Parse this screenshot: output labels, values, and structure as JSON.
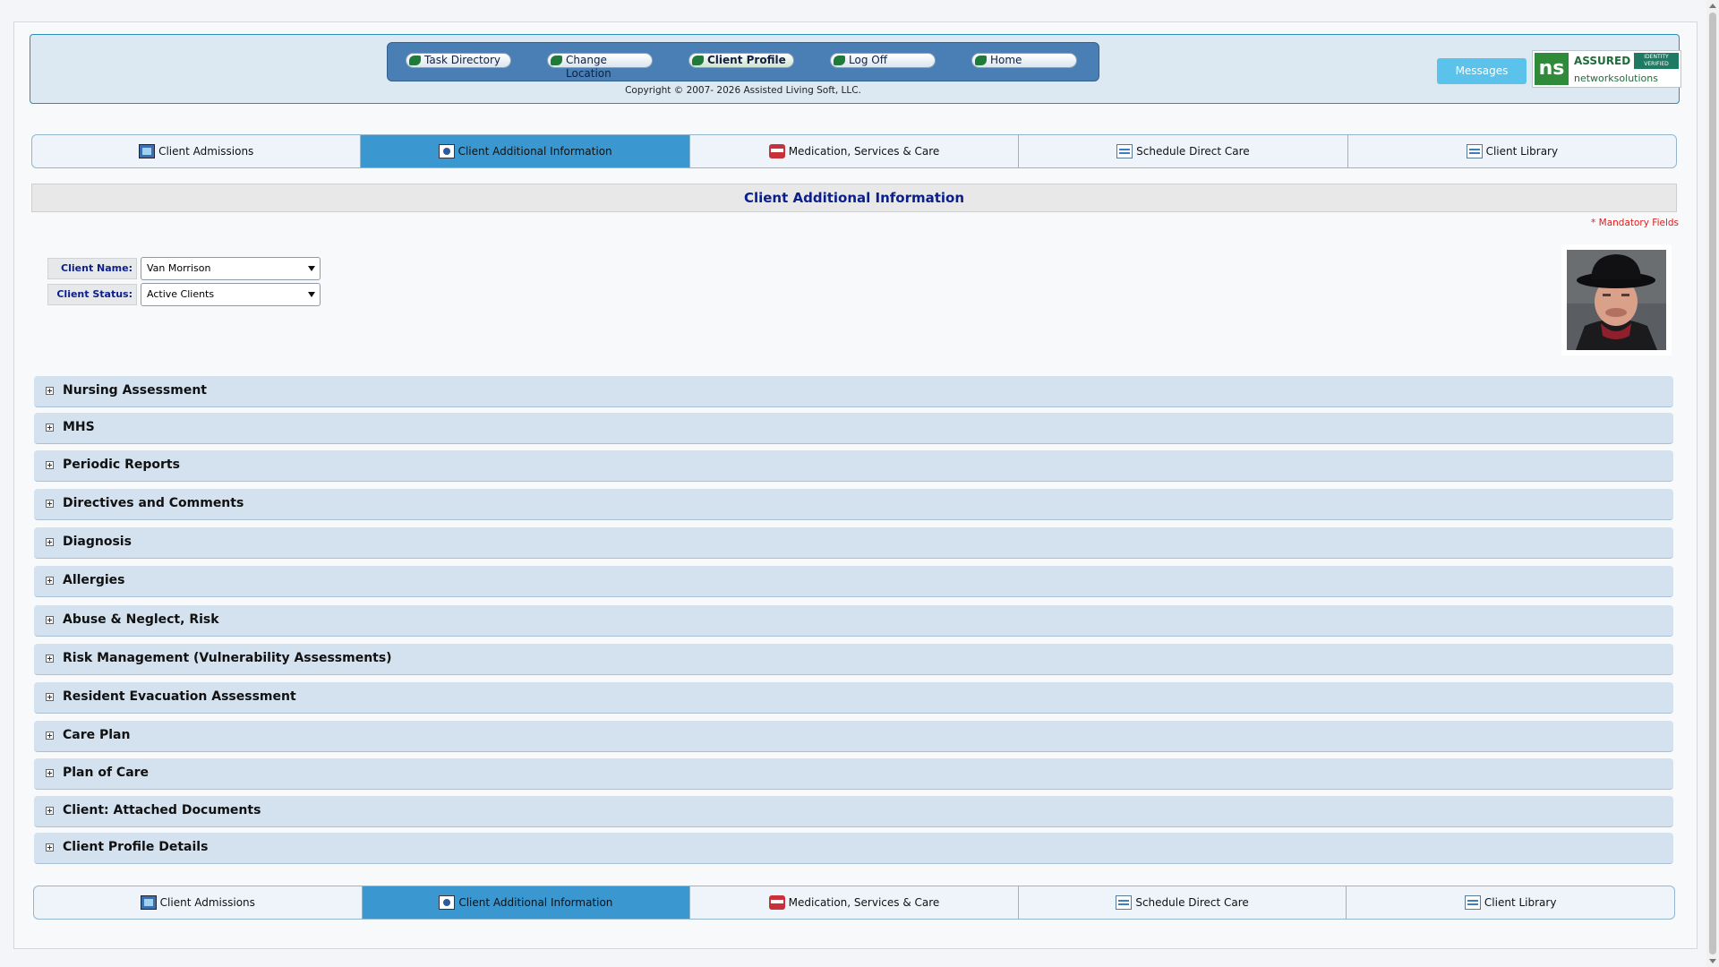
{
  "nav": {
    "buttons": [
      {
        "label": "Task Directory"
      },
      {
        "label": "Change Location"
      },
      {
        "label": "Client Profile"
      },
      {
        "label": "Log Off"
      },
      {
        "label": "Home"
      }
    ],
    "copyright": "Copyright © 2007- 2026 Assisted Living Soft, LLC.",
    "messages_label": "Messages"
  },
  "badge": {
    "logo": "ns",
    "assured": "ASSURED",
    "identity": "IDENTITY VERIFIED",
    "sub": "networksolutions"
  },
  "tabs": [
    {
      "label": "Client Admissions",
      "icon": "monitor-icon"
    },
    {
      "label": "Client Additional Information",
      "icon": "eye-icon",
      "active": true
    },
    {
      "label": "Medication, Services & Care",
      "icon": "pills-icon"
    },
    {
      "label": "Schedule Direct Care",
      "icon": "notepad-icon"
    },
    {
      "label": "Client Library",
      "icon": "notepad-icon"
    }
  ],
  "section_title": "Client Additional Information",
  "mandatory": "* Mandatory Fields",
  "form": {
    "client_name_label": "Client Name:",
    "client_name_value": "Van Morrison",
    "client_status_label": "Client Status:",
    "client_status_value": "Active Clients"
  },
  "sections": [
    "Nursing Assessment",
    "MHS",
    "Periodic Reports",
    "Directives and Comments",
    "Diagnosis",
    "Allergies",
    "Abuse & Neglect, Risk",
    "Risk Management (Vulnerability Assessments)",
    "Resident Evacuation Assessment",
    "Care Plan",
    "Plan of Care",
    "Client: Attached Documents",
    "Client Profile Details"
  ]
}
